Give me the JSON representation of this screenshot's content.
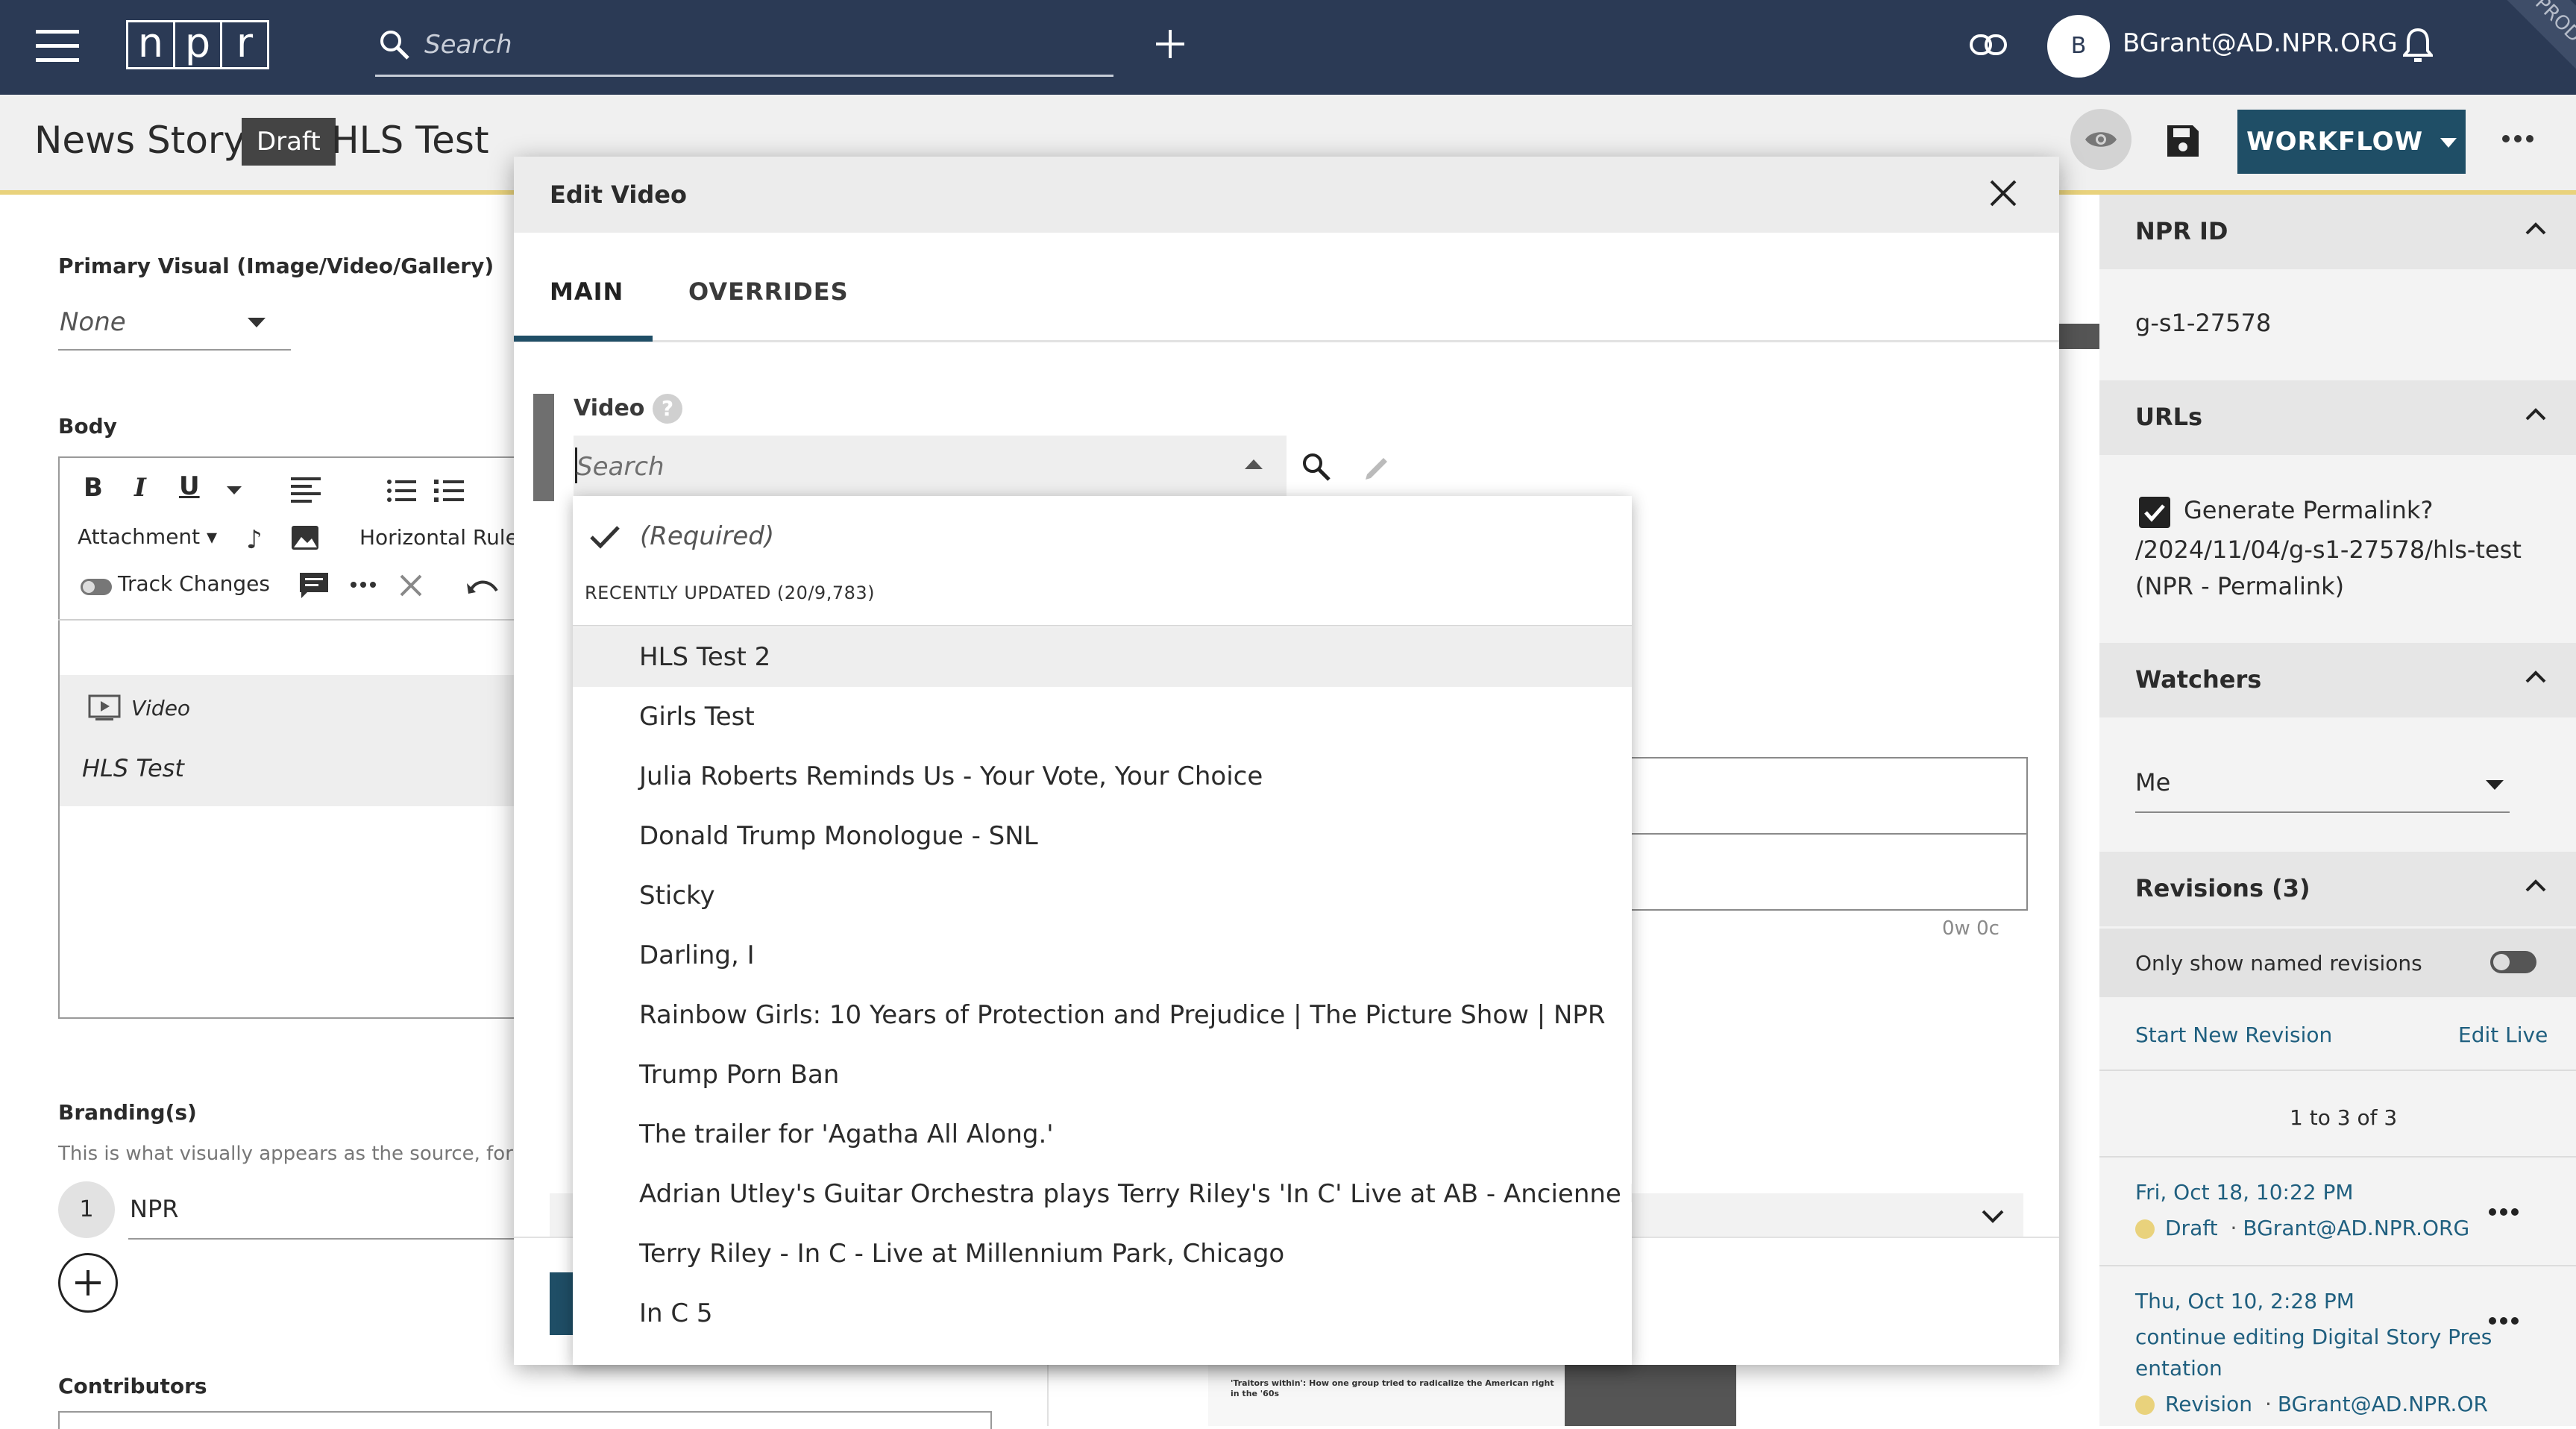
{
  "topbar": {
    "search_placeholder": "Search",
    "user_initial": "B",
    "user_email": "BGrant@AD.NPR.ORG",
    "environment_ribbon": "PROD",
    "logo_letters": [
      "n",
      "p",
      "r"
    ]
  },
  "story_header": {
    "type_label": "News Story:",
    "status_badge": "Draft",
    "title": "HLS Test",
    "workflow_label": "WORKFLOW"
  },
  "left_pane": {
    "primary_visual_label": "Primary Visual (Image/Video/Gallery)",
    "primary_visual_value": "None",
    "body_label": "Body",
    "toolbar": {
      "attachment": "Attachment",
      "horizontal_rule": "Horizontal Rule",
      "track_changes": "Track Changes"
    },
    "embed_type": "Video",
    "embed_title": "HLS Test",
    "branding_label": "Branding(s)",
    "branding_help": "This is what visually appears as the source, for",
    "branding_index": "1",
    "branding_value": "NPR",
    "contributors_label": "Contributors"
  },
  "right_sidebar": {
    "npr_id_header": "NPR ID",
    "npr_id_value": "g-s1-27578",
    "urls_header": "URLs",
    "generate_permalink_label": "Generate Permalink?",
    "permalink_path": "/2024/11/04/g-s1-27578/hls-test",
    "permalink_note": "(NPR - Permalink)",
    "watchers_header": "Watchers",
    "watchers_value": "Me",
    "revisions_header": "Revisions (3)",
    "only_named_label": "Only show named revisions",
    "start_new_revision": "Start New Revision",
    "edit_live": "Edit Live",
    "pagination": "1 to 3 of 3",
    "revisions": [
      {
        "date": "Fri, Oct 18, 10:22 PM",
        "status": "Draft",
        "separator": "·",
        "author": "BGrant@AD.NPR.ORG"
      },
      {
        "date": "Thu, Oct 10, 2:28 PM",
        "name_line1": "continue editing Digital Story Pres",
        "name_line2": "entation",
        "status": "Revision",
        "separator": "·",
        "author": "BGrant@AD.NPR.OR"
      }
    ]
  },
  "modal": {
    "title": "Edit Video",
    "tabs": [
      {
        "label": "MAIN",
        "active": true
      },
      {
        "label": "OVERRIDES",
        "active": false
      }
    ],
    "video_field_label": "Video",
    "help_glyph": "?",
    "video_search_placeholder": "Search",
    "counter": "0w 0c"
  },
  "dropdown": {
    "required_option": "(Required)",
    "section_label": "RECENTLY UPDATED (20/9,783)",
    "items": [
      "HLS Test 2",
      "Girls Test",
      "Julia Roberts Reminds Us - Your Vote, Your Choice",
      "Donald Trump Monologue - SNL",
      "Sticky",
      "Darling, I",
      "Rainbow Girls: 10 Years of Protection and Prejudice | The Picture Show | NPR",
      "Trump Porn Ban",
      "The trailer for 'Agatha All Along.'",
      "Adrian Utley's Guitar Orchestra plays Terry Riley's 'In C' Live at AB - Ancienne Belgique",
      "Terry Riley - In C - Live at Millennium Park, Chicago",
      "In C 5"
    ],
    "highlighted_index": 0
  },
  "thumbnail_caption": "'Traitors within': How one group tried to radicalize the American right in the '60s",
  "colors": {
    "topbar": "#2b3a55",
    "accent": "#1f4e66",
    "draft_dot": "#e9d27c"
  }
}
